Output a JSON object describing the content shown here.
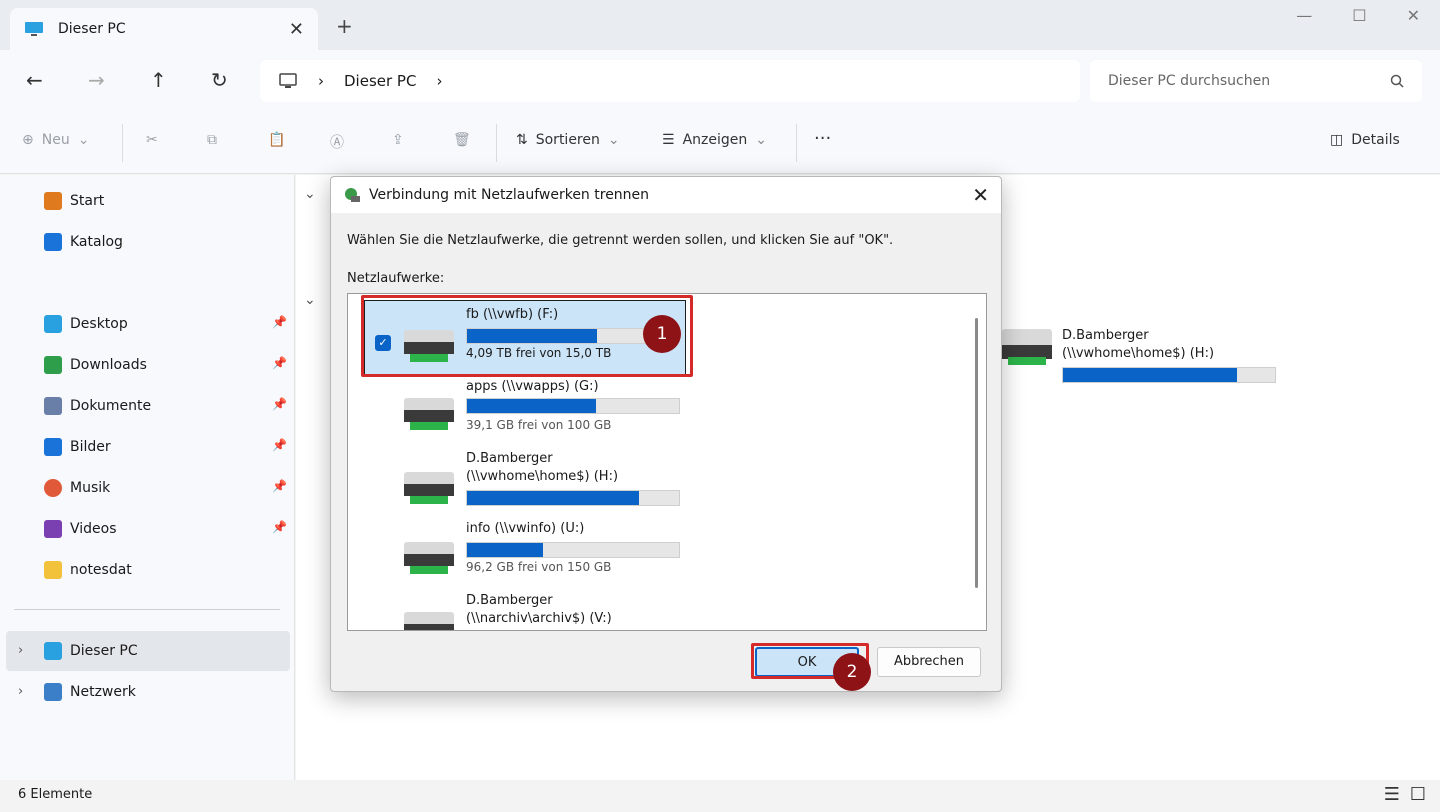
{
  "window": {
    "tab_title": "Dieser PC",
    "tab_close": "✕",
    "new_tab": "+",
    "minimize": "—",
    "maximize": "☐",
    "close": "✕"
  },
  "nav": {
    "back": "←",
    "forward": "→",
    "up": "↑",
    "refresh": "↻",
    "breadcrumb": "Dieser PC",
    "search_placeholder": "Dieser PC durchsuchen"
  },
  "toolbar": {
    "new_label": "Neu",
    "sort_label": "Sortieren",
    "view_label": "Anzeigen",
    "more_label": "···",
    "details_label": "Details"
  },
  "sidebar": {
    "items": [
      {
        "label": "Start",
        "color": "#e07a1f"
      },
      {
        "label": "Katalog",
        "color": "#1a73d8"
      },
      {
        "label": "Desktop",
        "color": "#29a0e0"
      },
      {
        "label": "Downloads",
        "color": "#2e9e4a"
      },
      {
        "label": "Dokumente",
        "color": "#6a7fa8"
      },
      {
        "label": "Bilder",
        "color": "#1a73d8"
      },
      {
        "label": "Musik",
        "color": "#e05a3a"
      },
      {
        "label": "Videos",
        "color": "#7a3fb0"
      },
      {
        "label": "notesdat",
        "color": "#f2c23a"
      },
      {
        "label": "Dieser PC",
        "color": "#29a0e0"
      },
      {
        "label": "Netzwerk",
        "color": "#3a7fc8"
      }
    ],
    "pin": "📌"
  },
  "background_drive": {
    "name_line1": "D.Bamberger",
    "name_line2": "(\\\\vwhome\\home$) (H:)",
    "fill_fraction": 0.82
  },
  "dialog": {
    "title": "Verbindung mit Netzlaufwerken trennen",
    "close": "✕",
    "instruction": "Wählen Sie die Netzlaufwerke, die getrennt werden sollen, und klicken Sie auf \"OK\".",
    "list_label": "Netzlaufwerke:",
    "drives": [
      {
        "name": "fb (\\\\vwfb) (F:)",
        "free": "4,09 TB frei von 15,0 TB",
        "fill_fraction": 0.73,
        "selected": true,
        "checkmark": "✓"
      },
      {
        "name": "apps (\\\\vwapps) (G:)",
        "free": "39,1 GB frei von 100 GB",
        "fill_fraction": 0.61,
        "selected": false
      },
      {
        "name": "D.Bamberger\n(\\\\vwhome\\home$) (H:)",
        "free": "",
        "fill_fraction": 0.81,
        "selected": false
      },
      {
        "name": "info (\\\\vwinfo) (U:)",
        "free": "96,2 GB frei von 150 GB",
        "fill_fraction": 0.36,
        "selected": false
      },
      {
        "name": "D.Bamberger\n(\\\\narchiv\\archiv$) (V:)",
        "free": "",
        "fill_fraction": 0.0,
        "selected": false
      }
    ],
    "ok_label": "OK",
    "cancel_label": "Abbrechen",
    "marker_1": "1",
    "marker_2": "2"
  },
  "statusbar": {
    "count": "6 Elemente"
  }
}
